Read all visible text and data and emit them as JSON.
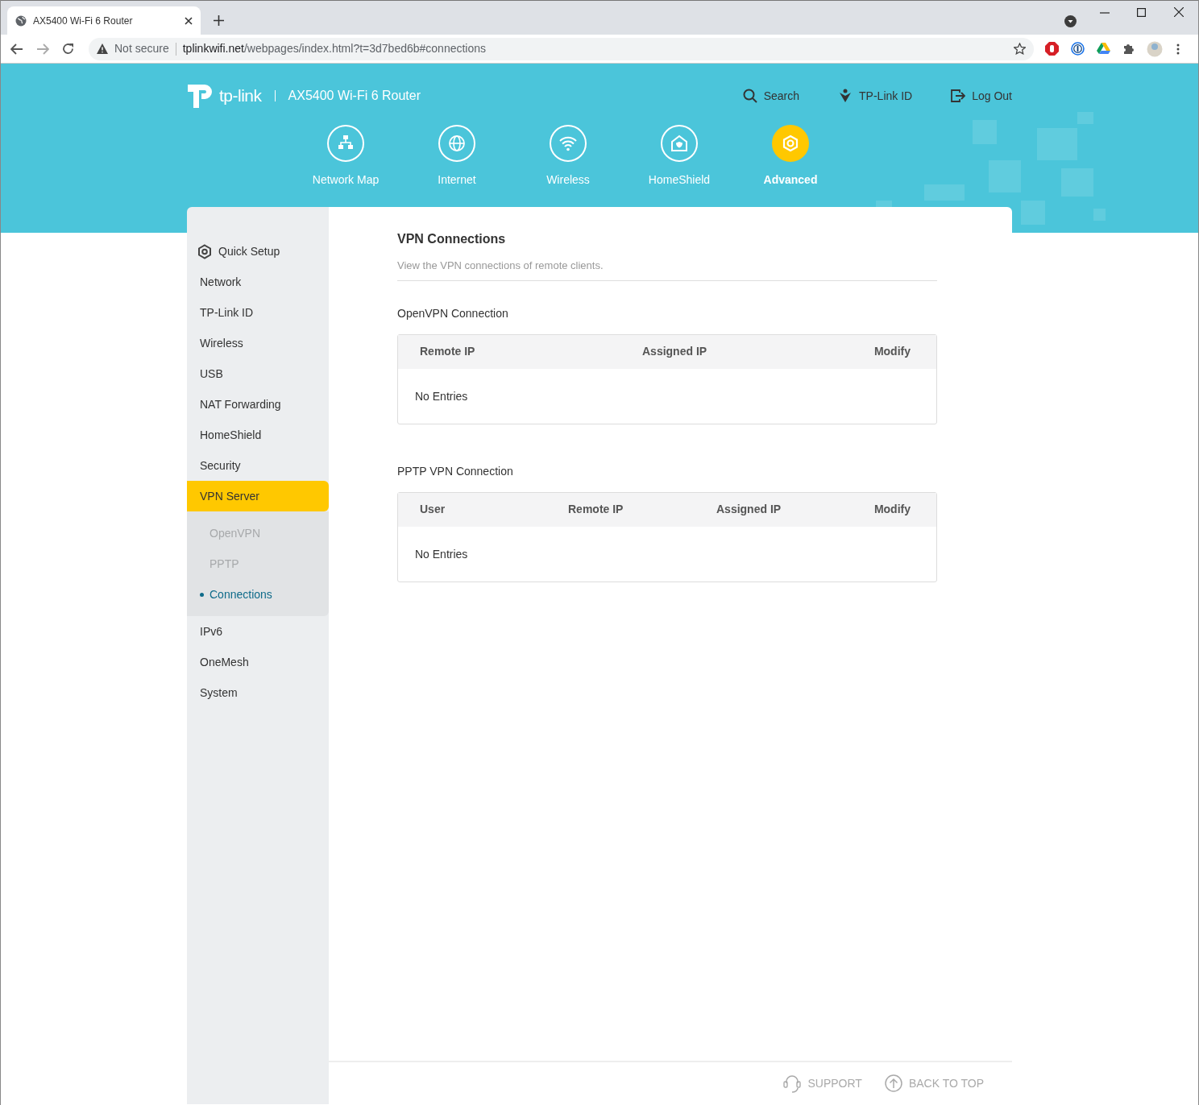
{
  "browser": {
    "tab_title": "AX5400 Wi-Fi 6 Router",
    "security": "Not secure",
    "url_host": "tplinkwifi.net",
    "url_path": "/webpages/index.html?t=3d7bed6b#connections"
  },
  "header": {
    "brand": "tp-link",
    "model": "AX5400 Wi-Fi 6 Router",
    "links": [
      {
        "label": "Search",
        "kind": "search"
      },
      {
        "label": "TP-Link ID",
        "kind": "id"
      },
      {
        "label": "Log Out",
        "kind": "logout"
      }
    ],
    "nav": [
      {
        "label": "Network Map",
        "kind": "map",
        "selected": false
      },
      {
        "label": "Internet",
        "kind": "globe",
        "selected": false
      },
      {
        "label": "Wireless",
        "kind": "wifi",
        "selected": false
      },
      {
        "label": "HomeShield",
        "kind": "shield",
        "selected": false
      },
      {
        "label": "Advanced",
        "kind": "gear",
        "selected": true
      }
    ]
  },
  "sidebar": [
    {
      "label": "Quick Setup",
      "kind": "setup",
      "selected": false
    },
    {
      "label": "Network",
      "kind": "link",
      "selected": false
    },
    {
      "label": "TP-Link ID",
      "kind": "link",
      "selected": false
    },
    {
      "label": "Wireless",
      "kind": "link",
      "selected": false
    },
    {
      "label": "USB",
      "kind": "link",
      "selected": false
    },
    {
      "label": "NAT Forwarding",
      "kind": "link",
      "selected": false
    },
    {
      "label": "HomeShield",
      "kind": "link",
      "selected": false
    },
    {
      "label": "Security",
      "kind": "link",
      "selected": false
    },
    {
      "label": "VPN Server",
      "kind": "link",
      "selected": true,
      "children": [
        {
          "label": "OpenVPN",
          "selected": false
        },
        {
          "label": "PPTP",
          "selected": false
        },
        {
          "label": "Connections",
          "selected": true
        }
      ]
    },
    {
      "label": "IPv6",
      "kind": "link",
      "selected": false
    },
    {
      "label": "OneMesh",
      "kind": "link",
      "selected": false
    },
    {
      "label": "System",
      "kind": "link",
      "selected": false
    }
  ],
  "content": {
    "title": "VPN Connections",
    "description": "View the VPN connections of remote clients.",
    "sections": [
      {
        "title": "OpenVPN Connection",
        "columns": [
          "Remote IP",
          "Assigned IP",
          "Modify"
        ],
        "empty_text": "No Entries"
      },
      {
        "title": "PPTP VPN Connection",
        "columns": [
          "User",
          "Remote IP",
          "Assigned IP",
          "Modify"
        ],
        "empty_text": "No Entries"
      }
    ]
  },
  "footer": [
    {
      "label": "SUPPORT",
      "kind": "support"
    },
    {
      "label": "BACK TO TOP",
      "kind": "top"
    }
  ]
}
